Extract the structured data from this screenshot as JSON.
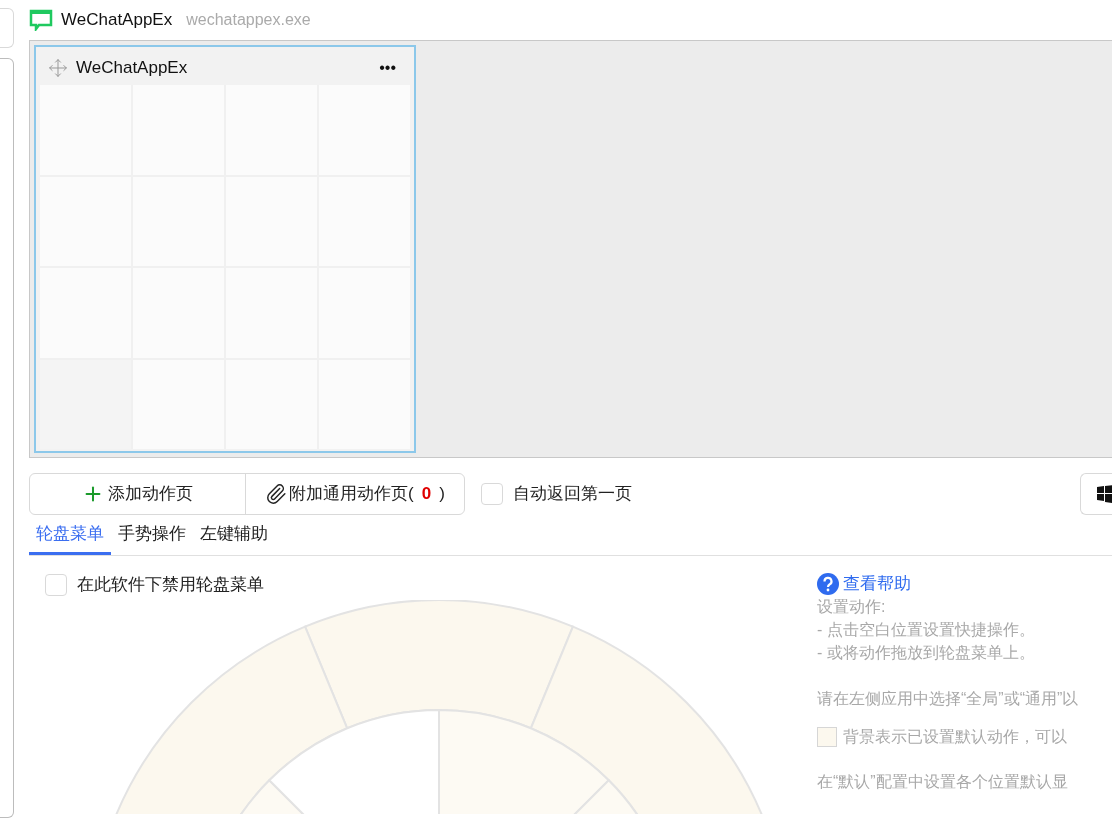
{
  "app": {
    "name": "WeChatAppEx",
    "process": "wechatappex.exe"
  },
  "page_card": {
    "title": "WeChatAppEx",
    "menu": "•••",
    "selected": true
  },
  "toolbar": {
    "add_label": "添加动作页",
    "attach_label": "附加通用动作页(",
    "attach_count": "0",
    "attach_close": ")",
    "auto_return": {
      "label": "自动返回第一页",
      "checked": false
    }
  },
  "tabs": [
    {
      "label": "轮盘菜单",
      "selected": true
    },
    {
      "label": "手势操作",
      "selected": false
    },
    {
      "label": "左键辅助",
      "selected": false
    }
  ],
  "disable_option": {
    "label": "在此软件下禁用轮盘菜单",
    "checked": false
  },
  "help": {
    "link": "查看帮助",
    "lines": [
      "设置动作:",
      "- 点击空白位置设置快捷操作。",
      "- 或将动作拖放到轮盘菜单上。"
    ],
    "hint": "请在左侧应用中选择“全局”或“通用”以",
    "legend": "背景表示已设置默认动作，可以",
    "footer": "在“默认”配置中设置各个位置默认显"
  }
}
